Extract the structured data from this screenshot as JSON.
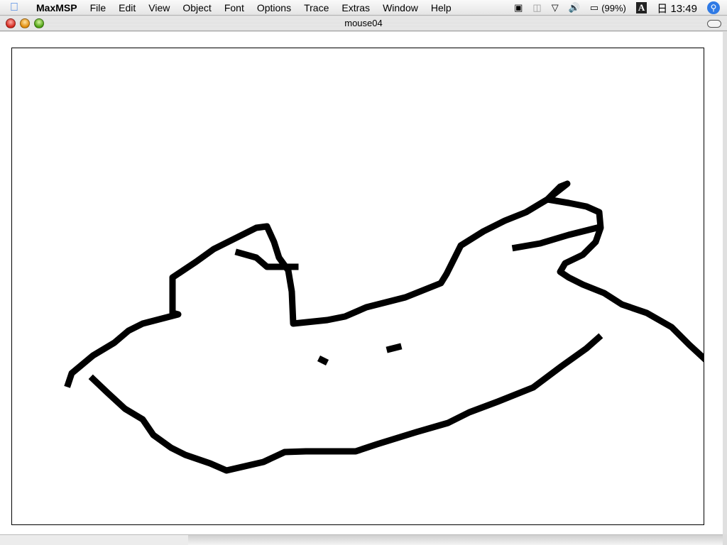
{
  "menubar": {
    "app": "MaxMSP",
    "items": [
      "File",
      "Edit",
      "View",
      "Object",
      "Font",
      "Options",
      "Trace",
      "Extras",
      "Window",
      "Help"
    ],
    "battery": "(99%)",
    "input_menu": "A",
    "clock_prefix": "日",
    "clock": "13:49"
  },
  "window": {
    "title": "mouse04"
  },
  "drawing": {
    "stroke_color": "#000000",
    "background": "#ffffff"
  }
}
